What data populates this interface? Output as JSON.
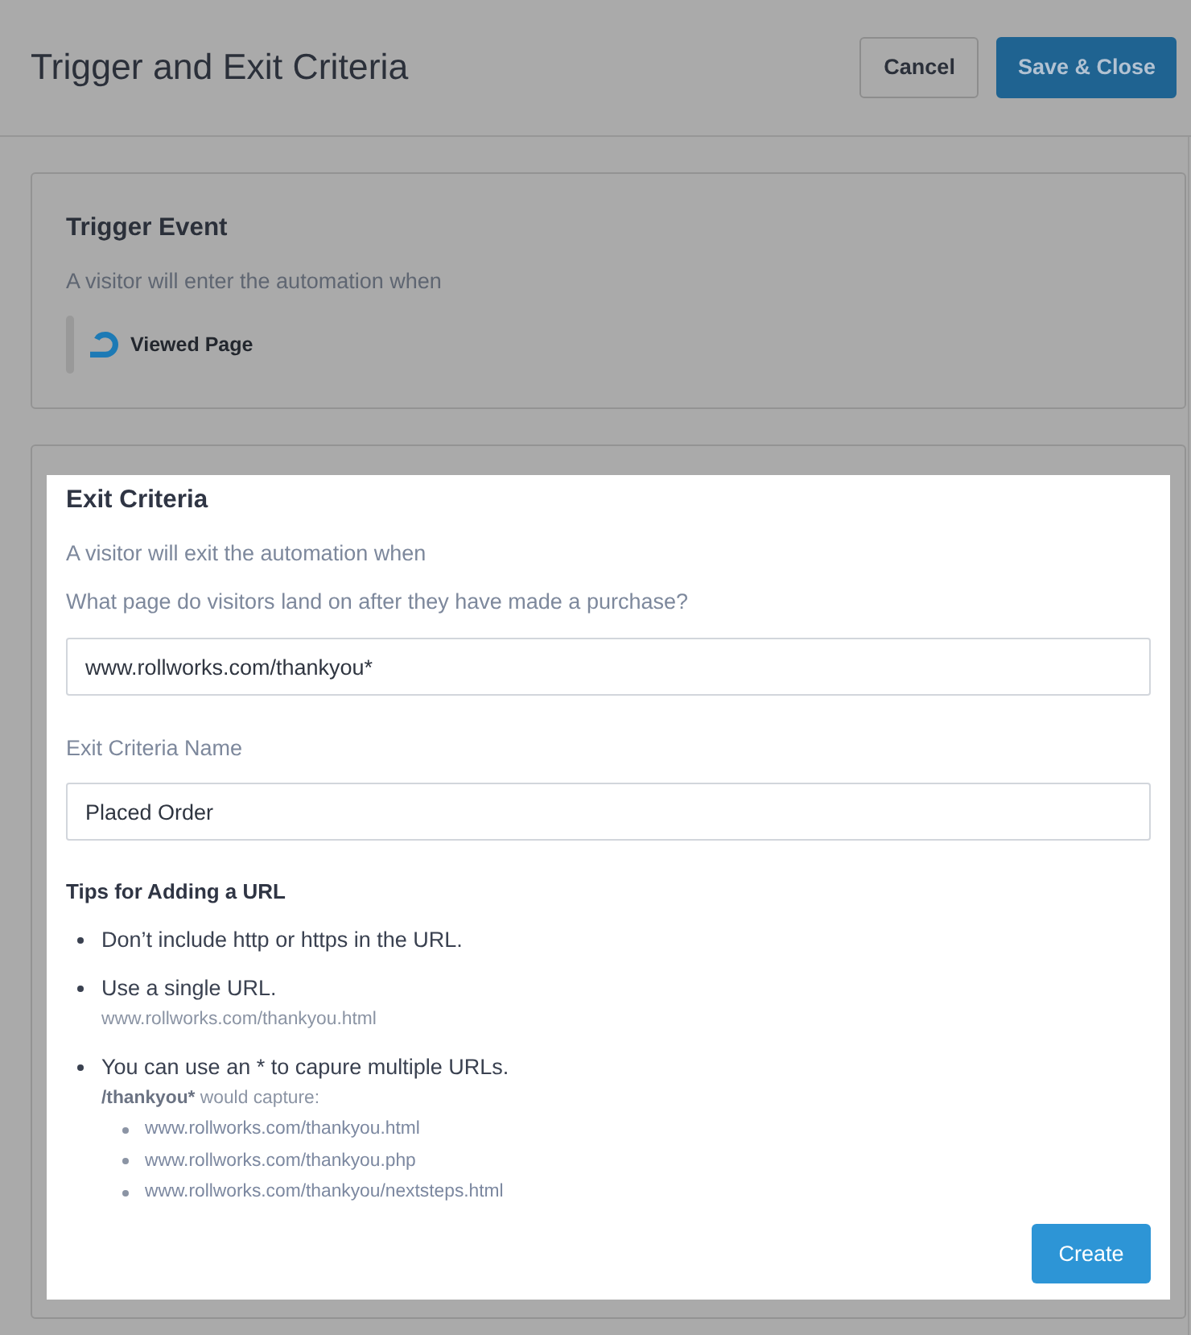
{
  "header": {
    "title": "Trigger and Exit Criteria",
    "buttons": [
      {
        "label": "Cancel",
        "kind": "secondary"
      },
      {
        "label": "Save & Close",
        "kind": "primary"
      }
    ]
  },
  "trigger_event": {
    "title": "Trigger Event",
    "subtitle": "A visitor will enter the automation when",
    "event": {
      "label": "Viewed Page"
    }
  },
  "exit_criteria": {
    "highlighted": true,
    "title": "Exit Criteria",
    "subtitle": "A visitor will exit the automation when",
    "url_label": "What page do visitors land on after they have made a purchase?",
    "url_field": {
      "value": "www.rollworks.com/thankyou*"
    },
    "name_label": "Exit Criteria Name",
    "name_field": {
      "value": "Placed Order"
    },
    "tips": {
      "title": "Tips for Adding a URL",
      "items": [
        {
          "text": "Don’t include http or https in the URL."
        },
        {
          "text": "Use a single URL.",
          "note": {
            "text": "www.rollworks.com/thankyou.html"
          }
        },
        {
          "text": "You can use an * to capure multiple URLs.",
          "note": {
            "lead": "/thankyou*",
            "text": "would capture:"
          },
          "examples": [
            "www.rollworks.com/thankyou.html",
            "www.rollworks.com/thankyou.php",
            "www.rollworks.com/thankyou/nextsteps.html"
          ]
        }
      ]
    },
    "create_button": {
      "label": "Create"
    }
  }
}
